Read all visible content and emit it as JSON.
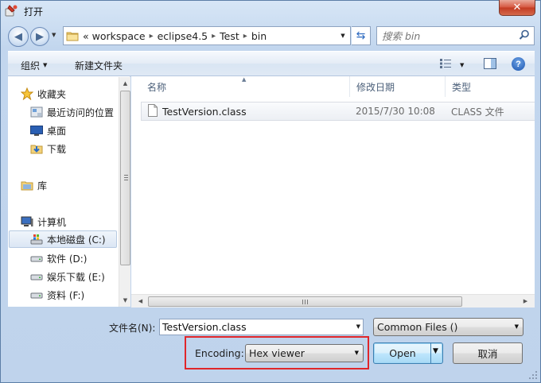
{
  "window": {
    "title": "打开",
    "close_label": "✕"
  },
  "address": {
    "overflow": "«",
    "crumbs": [
      "workspace",
      "eclipse4.5",
      "Test",
      "bin"
    ]
  },
  "search": {
    "placeholder": "搜索 bin"
  },
  "toolbar": {
    "organize_label": "组织",
    "new_folder_label": "新建文件夹"
  },
  "nav": {
    "items": [
      {
        "label": "收藏夹",
        "icon": "star-icon"
      },
      {
        "label": "最近访问的位置",
        "icon": "recent-places-icon"
      },
      {
        "label": "桌面",
        "icon": "desktop-icon"
      },
      {
        "label": "下载",
        "icon": "downloads-icon"
      },
      {
        "label": "库",
        "icon": "library-icon"
      },
      {
        "label": "计算机",
        "icon": "computer-icon"
      },
      {
        "label": "本地磁盘 (C:)",
        "icon": "windows-drive-icon"
      },
      {
        "label": "软件 (D:)",
        "icon": "drive-icon"
      },
      {
        "label": "娱乐下载 (E:)",
        "icon": "drive-icon"
      },
      {
        "label": "资料 (F:)",
        "icon": "drive-icon"
      }
    ]
  },
  "filelist": {
    "columns": [
      "名称",
      "修改日期",
      "类型"
    ],
    "rows": [
      {
        "name": "TestVersion.class",
        "date": "2015/7/30 10:08",
        "type": "CLASS 文件"
      }
    ]
  },
  "bottom": {
    "filename_label": "文件名(N):",
    "filename_value": "TestVersion.class",
    "filter_value": "Common Files ()",
    "encoding_label": "Encoding:",
    "encoding_value": "Hex viewer",
    "open_label": "Open",
    "cancel_label": "取消"
  },
  "colors": {
    "highlight_box": "#e0262a",
    "accent": "#3c7fb1"
  }
}
